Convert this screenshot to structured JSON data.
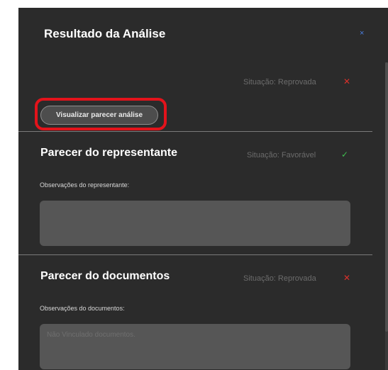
{
  "header": {
    "title": "Resultado da Análise",
    "close_symbol": "×"
  },
  "analysis": {
    "status": "Situação: Reprovada",
    "status_symbol": "✕",
    "button_label": "Visualizar parecer análise"
  },
  "representante": {
    "title": "Parecer do representante",
    "status": "Situação: Favorável",
    "status_symbol": "✓",
    "obs_label": "Observações do representante:",
    "obs_value": ""
  },
  "documentos": {
    "title": "Parecer do documentos",
    "status": "Situação: Reprovada",
    "status_symbol": "✕",
    "obs_label": "Observações do documentos:",
    "obs_value": "Não Vinculado documentos."
  },
  "colors": {
    "panel_bg": "#2b2b2b",
    "status_reprovada": "#d9302b",
    "status_favoravel": "#3fbd4f",
    "highlight": "#e3131b"
  },
  "icons": {
    "close": "close-icon",
    "reprovada": "x-mark-icon",
    "favoravel": "checkmark-icon"
  }
}
